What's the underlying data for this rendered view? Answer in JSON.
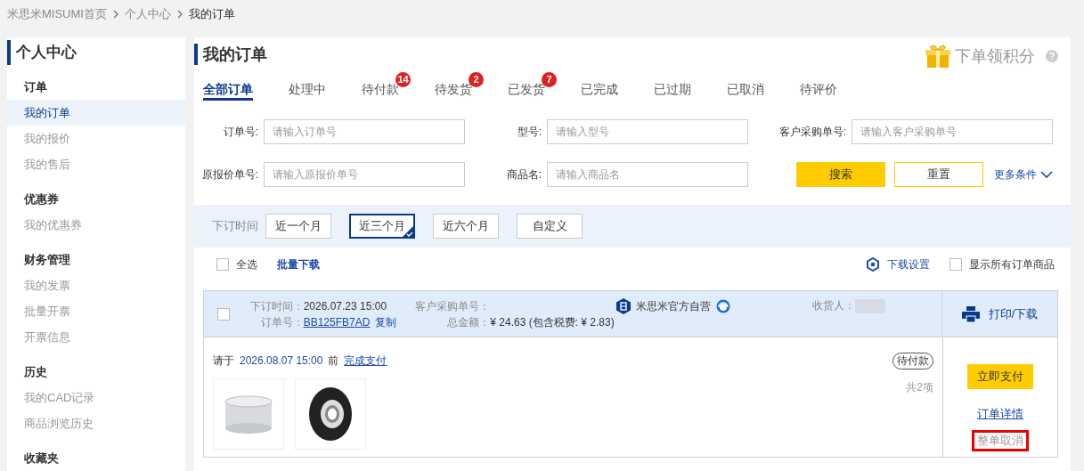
{
  "breadcrumb": [
    {
      "label": "米思米MISUMI首页",
      "current": false
    },
    {
      "label": "个人中心",
      "current": false
    },
    {
      "label": "我的订单",
      "current": true
    }
  ],
  "sidebar": {
    "title": "个人中心",
    "sections": [
      {
        "heading": "订单",
        "items": [
          {
            "label": "我的订单",
            "selected": true
          },
          {
            "label": "我的报价",
            "selected": false
          },
          {
            "label": "我的售后",
            "selected": false
          }
        ]
      },
      {
        "heading": "优惠券",
        "items": [
          {
            "label": "我的优惠券",
            "selected": false
          }
        ]
      },
      {
        "heading": "财务管理",
        "items": [
          {
            "label": "我的发票",
            "selected": false
          },
          {
            "label": "批量开票",
            "selected": false
          },
          {
            "label": "开票信息",
            "selected": false
          }
        ]
      },
      {
        "heading": "历史",
        "items": [
          {
            "label": "我的CAD记录",
            "selected": false
          },
          {
            "label": "商品浏览历史",
            "selected": false
          }
        ]
      },
      {
        "heading": "收藏夹"
      }
    ]
  },
  "page": {
    "title": "我的订单",
    "points_link": "下单领积分"
  },
  "tabs": [
    {
      "label": "全部订单",
      "selected": true
    },
    {
      "label": "处理中",
      "selected": false
    },
    {
      "label": "待付款",
      "selected": false,
      "badge": "14"
    },
    {
      "label": "待发货",
      "selected": false,
      "badge": "2"
    },
    {
      "label": "已发货",
      "selected": false,
      "badge": "7"
    },
    {
      "label": "已完成",
      "selected": false
    },
    {
      "label": "已过期",
      "selected": false
    },
    {
      "label": "已取消",
      "selected": false
    },
    {
      "label": "待评价",
      "selected": false
    }
  ],
  "filters": [
    {
      "label": "订单号:",
      "placeholder": "请输入订单号"
    },
    {
      "label": "型号:",
      "placeholder": "请输入型号"
    },
    {
      "label": "客户采购单号:",
      "placeholder": "请输入客户采购单号"
    },
    {
      "label": "原报价单号:",
      "placeholder": "请输入原报价单号"
    },
    {
      "label": "商品名:",
      "placeholder": "请输入商品名"
    }
  ],
  "filter_buttons": {
    "search": "搜索",
    "reset": "重置",
    "more": "更多条件"
  },
  "time_filter": {
    "label": "下订时间",
    "options": [
      {
        "label": "近一个月",
        "selected": false
      },
      {
        "label": "近三个月",
        "selected": true
      },
      {
        "label": "近六个月",
        "selected": false
      },
      {
        "label": "自定义",
        "selected": false
      }
    ]
  },
  "toolbar": {
    "select_all": {
      "label": "全选",
      "checked": false
    },
    "bulk_download": "批量下载",
    "download_settings": "下载设置",
    "show_all": {
      "label": "显示所有订单商品",
      "checked": false
    }
  },
  "order": {
    "checked": false,
    "order_time_label": "下订时间：",
    "order_time": "2026.07.23 15:00",
    "order_no_label": "订单号：",
    "order_no": "BB125FB7AD",
    "copy": "复制",
    "po_label": "客户采购单号：",
    "total_label": "总金额：",
    "total": "¥ 24.63 (包含税费: ¥ 2.83)",
    "seller": "米思米官方自营",
    "recipient_label": "收货人：",
    "print": "打印/下载",
    "notice": {
      "prefix": "请于",
      "deadline": "2026.08.07 15:00",
      "middle": "前",
      "link": "完成支付"
    },
    "status": "待付款",
    "count": "共2项",
    "products": [
      {
        "kind": "cylinder"
      },
      {
        "kind": "bearing"
      }
    ],
    "actions": [
      {
        "kind": "primary",
        "label": "立即支付",
        "highlighted": false
      },
      {
        "kind": "link",
        "label": "订单详情",
        "highlighted": false
      },
      {
        "kind": "muted",
        "label": "整单取消",
        "highlighted": true
      }
    ]
  }
}
